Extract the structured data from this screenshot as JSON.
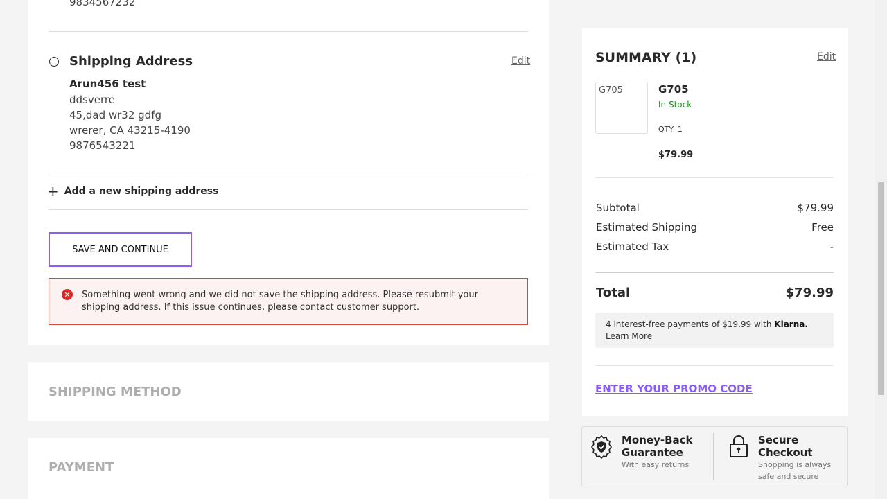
{
  "prev_section": {
    "phone": "9834567232"
  },
  "shipping": {
    "title": "Shipping Address",
    "edit_label": "Edit",
    "name": "Arun456 test",
    "line1": "ddsverre",
    "line2": "45,dad wr32 gdfg",
    "line3": "wrerer, CA 43215-4190",
    "phone": "9876543221",
    "add_new_label": "Add a new shipping address",
    "save_label": "SAVE AND CONTINUE",
    "error_message": "Something went wrong and we did not save the shipping address. Please resubmit your shipping address. If this issue continues, please contact customer support."
  },
  "sections": {
    "shipping_method": "SHIPPING METHOD",
    "payment": "PAYMENT"
  },
  "summary": {
    "title": "SUMMARY (1)",
    "edit_label": "Edit",
    "product": {
      "image_alt": "G705",
      "name": "G705",
      "stock": "In Stock",
      "qty": "QTY: 1",
      "price": "$79.99"
    },
    "rows": [
      {
        "label": "Subtotal",
        "value": "$79.99"
      },
      {
        "label": "Estimated Shipping",
        "value": "Free"
      },
      {
        "label": "Estimated Tax",
        "value": "-"
      }
    ],
    "total_label": "Total",
    "total_value": "$79.99",
    "klarna_text": "4 interest-free payments of $19.99 with",
    "klarna_brand": "Klarna.",
    "klarna_link": "Learn More",
    "promo_label": "ENTER YOUR PROMO CODE"
  },
  "trust": {
    "guarantee_title": "Money-Back Guarantee",
    "guarantee_sub": "With easy returns",
    "secure_title": "Secure Checkout",
    "secure_sub": "Shopping is always safe and secure"
  },
  "colors": {
    "accent": "#8b5cf6",
    "error": "#d62a2a",
    "in_stock": "#1a8a1a"
  }
}
